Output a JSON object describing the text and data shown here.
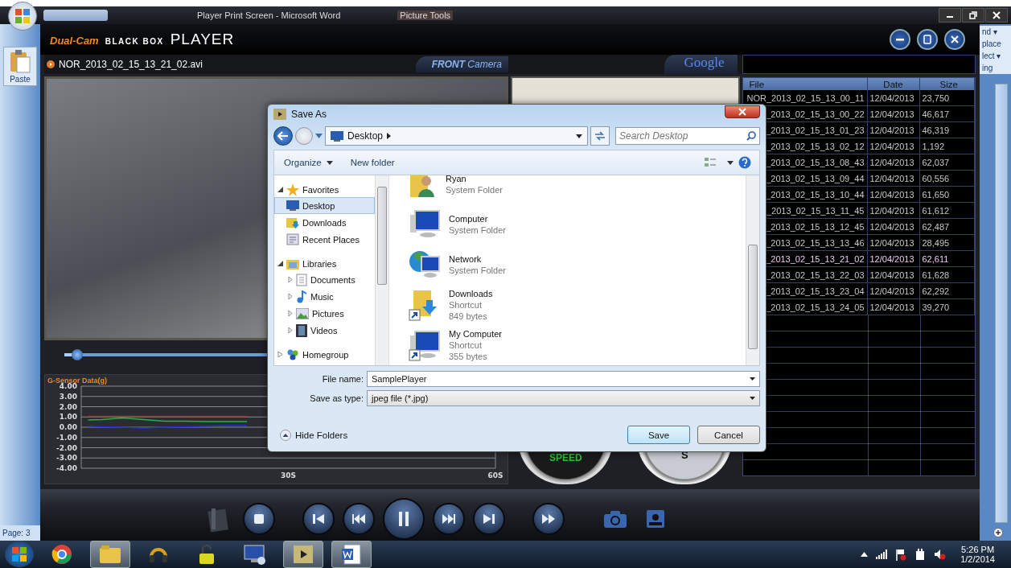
{
  "word_window": {
    "title": "Player Print Screen - Microsoft Word",
    "context_tab": "Picture Tools",
    "paste_label": "Paste",
    "ribbon_right": [
      "nd ▾",
      "place",
      "lect ▾",
      "ing"
    ],
    "status": "Page: 3"
  },
  "player": {
    "logo": {
      "brand": "Dual-Cam",
      "product": "BLACK BOX",
      "name": "PLAYER"
    },
    "video": {
      "filename": "NOR_2013_02_15_13_21_02.avi",
      "camera_tab": "**FRONT** Camera",
      "position": {
        "level": 0.03
      }
    },
    "map_tab": "Google",
    "gauges": {
      "speed": "SPEED",
      "compass": "S"
    },
    "chart": {
      "title": "G-Sensor Data(g)",
      "chart_data": {
        "type": "line",
        "x": [
          1,
          3,
          6,
          9,
          12,
          15,
          18,
          21,
          24
        ],
        "series": [
          {
            "color": "#c0282d",
            "values": [
              1.05,
              1.05,
              1.05,
              1.05,
              1.05,
              1.05,
              1.05,
              1.05,
              1.05
            ]
          },
          {
            "color": "#22b14c",
            "values": [
              0.7,
              0.75,
              0.9,
              0.75,
              0.6,
              0.6,
              0.55,
              0.55,
              0.55
            ]
          },
          {
            "color": "#1f2fd6",
            "values": [
              0.1,
              0.05,
              0,
              -0.1,
              0,
              0.05,
              0.1,
              0.15,
              0.15
            ]
          }
        ],
        "xlim": [
          0,
          60
        ],
        "ylim": [
          -4,
          4
        ],
        "grid": true,
        "xticks": [
          {
            "value": 30,
            "label": "30S"
          },
          {
            "value": 60,
            "label": "60S"
          }
        ],
        "yticks": [
          {
            "value": 4,
            "label": "4.00"
          },
          {
            "value": 3,
            "label": "3.00"
          },
          {
            "value": 2,
            "label": "2.00"
          },
          {
            "value": 1,
            "label": "1.00"
          },
          {
            "value": 0,
            "label": "0.00"
          },
          {
            "value": -1,
            "label": "-1.00"
          },
          {
            "value": -2,
            "label": "-2.00"
          },
          {
            "value": -3,
            "label": "-3.00"
          },
          {
            "value": -4,
            "label": "-4.00"
          }
        ]
      }
    },
    "file_table": {
      "columns": [
        "File",
        "Date",
        "Size"
      ],
      "rows": [
        {
          "file": "NOR_2013_02_15_13_00_11",
          "date": "12/04/2013",
          "size": "23,750",
          "selected": false
        },
        {
          "file": "_2013_02_15_13_00_22",
          "date": "12/04/2013",
          "size": "46,617",
          "selected": false
        },
        {
          "file": "_2013_02_15_13_01_23",
          "date": "12/04/2013",
          "size": "46,319",
          "selected": false
        },
        {
          "file": "_2013_02_15_13_02_12",
          "date": "12/04/2013",
          "size": "1,192",
          "selected": false
        },
        {
          "file": "_2013_02_15_13_08_43",
          "date": "12/04/2013",
          "size": "62,037",
          "selected": false
        },
        {
          "file": "_2013_02_15_13_09_44",
          "date": "12/04/2013",
          "size": "60,556",
          "selected": false
        },
        {
          "file": "_2013_02_15_13_10_44",
          "date": "12/04/2013",
          "size": "61,650",
          "selected": false
        },
        {
          "file": "_2013_02_15_13_11_45",
          "date": "12/04/2013",
          "size": "61,612",
          "selected": false
        },
        {
          "file": "_2013_02_15_13_12_45",
          "date": "12/04/2013",
          "size": "62,487",
          "selected": false
        },
        {
          "file": "_2013_02_15_13_13_46",
          "date": "12/04/2013",
          "size": "28,495",
          "selected": false
        },
        {
          "file": "_2013_02_15_13_21_02",
          "date": "12/04/2013",
          "size": "62,611",
          "selected": true
        },
        {
          "file": "_2013_02_15_13_22_03",
          "date": "12/04/2013",
          "size": "61,628",
          "selected": false
        },
        {
          "file": "_2013_02_15_13_23_04",
          "date": "12/04/2013",
          "size": "62,292",
          "selected": false
        },
        {
          "file": "_2013_02_15_13_24_05",
          "date": "12/04/2013",
          "size": "39,270",
          "selected": false
        }
      ]
    }
  },
  "dialog": {
    "title": "Save As",
    "location": "Desktop",
    "search": {
      "placeholder": "Search Desktop"
    },
    "toolbar": [
      "Organize",
      "New folder"
    ],
    "nav": [
      {
        "label": "Favorites",
        "kind": "star",
        "expanded": true,
        "children": [
          {
            "label": "Desktop",
            "kind": "desktop",
            "selected": true
          },
          {
            "label": "Downloads",
            "kind": "downloads",
            "selected": false
          },
          {
            "label": "Recent Places",
            "kind": "recent",
            "selected": false
          }
        ]
      },
      {
        "label": "Libraries",
        "kind": "library",
        "expanded": true,
        "children": [
          {
            "label": "Documents",
            "kind": "documents",
            "selected": false
          },
          {
            "label": "Music",
            "kind": "music",
            "selected": false
          },
          {
            "label": "Pictures",
            "kind": "pictures",
            "selected": false
          },
          {
            "label": "Videos",
            "kind": "videos",
            "selected": false
          }
        ]
      },
      {
        "label": "Homegroup",
        "kind": "homegroup",
        "expanded": false
      }
    ],
    "items": [
      {
        "name": "Ryan",
        "kind": "user",
        "details": [
          "System Folder"
        ]
      },
      {
        "name": "Computer",
        "kind": "computer",
        "details": [
          "System Folder"
        ]
      },
      {
        "name": "Network",
        "kind": "network",
        "details": [
          "System Folder"
        ]
      },
      {
        "name": "Downloads",
        "kind": "downloads",
        "details": [
          "Shortcut",
          "849 bytes"
        ]
      },
      {
        "name": "My Computer",
        "kind": "computer",
        "details": [
          "Shortcut",
          "355 bytes"
        ]
      }
    ],
    "file_name": {
      "label": "File name:",
      "value": "SamplePlayer"
    },
    "save_type": {
      "label": "Save as type:",
      "value": "jpeg file (*.jpg)"
    },
    "hide_folders": "Hide Folders",
    "buttons": [
      "Save",
      "Cancel"
    ]
  },
  "taskbar": {
    "clock_time": "5:26 PM",
    "clock_date": "1/2/2014"
  }
}
